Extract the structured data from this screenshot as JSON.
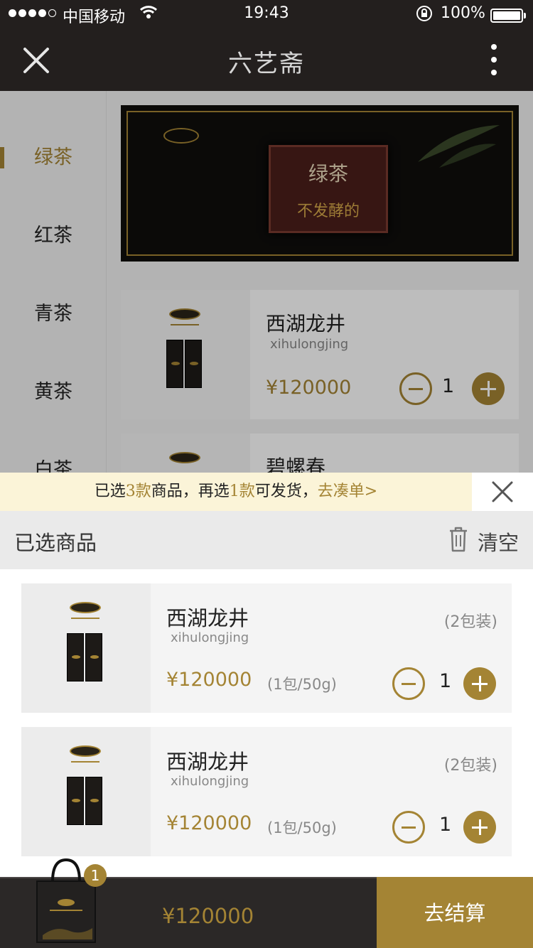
{
  "status_bar": {
    "carrier": "中国移动",
    "time": "19:43",
    "battery": "100%",
    "icons": [
      "signal-dots",
      "wifi-icon",
      "rotation-lock-icon",
      "battery-icon"
    ]
  },
  "nav": {
    "title": "六艺斋",
    "icons": [
      "close-icon",
      "more-vertical-icon"
    ]
  },
  "categories": [
    "绿茶",
    "红茶",
    "青茶",
    "黄茶",
    "白茶"
  ],
  "active_category": "绿茶",
  "banner": {
    "title": "绿茶",
    "subtitle": "不发酵的"
  },
  "products": [
    {
      "name": "西湖龙井",
      "pinyin": "xihulongjing",
      "price": "¥120000",
      "qty": "1"
    },
    {
      "name": "碧螺春"
    }
  ],
  "notice": {
    "p1": "已选",
    "n1": "3款",
    "p2": "商品，再选",
    "n2": "1款",
    "p3": "可发货，",
    "link": "去凑单>"
  },
  "selected": {
    "title": "已选商品",
    "clear_label": "清空",
    "items": [
      {
        "name": "西湖龙井",
        "pinyin": "xihulongjing",
        "pack": "(2包装)",
        "price": "¥120000",
        "unit": "(1包/50g)",
        "qty": "1"
      },
      {
        "name": "西湖龙井",
        "pinyin": "xihulongjing",
        "pack": "(2包装)",
        "price": "¥120000",
        "unit": "(1包/50g)",
        "qty": "1"
      }
    ]
  },
  "bottom": {
    "badge": "1",
    "total": "¥120000",
    "checkout_label": "去结算"
  },
  "colors": {
    "accent": "#a48434",
    "dark": "#231f1e",
    "notice_bg": "#fbf4d8"
  }
}
